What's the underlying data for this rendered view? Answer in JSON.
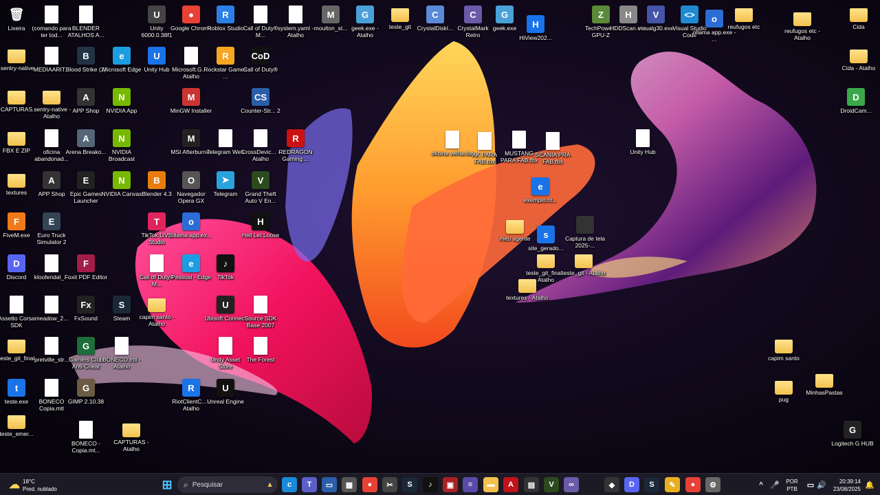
{
  "desktop": {
    "icons": [
      {
        "label": "Lixeira",
        "kind": "bin",
        "color": "#cfe3ff",
        "glyph": "🗑"
      },
      {
        "label": "(comando para ter tod...",
        "kind": "file",
        "color": "#ffffff",
        "glyph": ""
      },
      {
        "label": "BLENDER ATALHOS A...",
        "kind": "file",
        "color": "#ffffff",
        "glyph": ""
      },
      {
        "label": "Unity 6000.0.38f1",
        "kind": "app",
        "color": "#444444",
        "glyph": "U"
      },
      {
        "label": "Google Chrome",
        "kind": "app",
        "color": "#e84135",
        "glyph": "●"
      },
      {
        "label": "Roblox Studio",
        "kind": "app",
        "color": "#2b7fe6",
        "glyph": "R"
      },
      {
        "label": "Call of Duty® M...",
        "kind": "file",
        "color": "#ffffff",
        "glyph": ""
      },
      {
        "label": "system.yaml - Atalho",
        "kind": "file",
        "color": "#ffffff",
        "glyph": ""
      },
      {
        "label": "moulton_st...",
        "kind": "app",
        "color": "#666666",
        "glyph": "M"
      },
      {
        "label": "geek.exe - Atalho",
        "kind": "app",
        "color": "#4aa0d8",
        "glyph": "G"
      },
      {
        "label": "teste_git",
        "kind": "folder",
        "color": "#f2c14e",
        "glyph": ""
      },
      {
        "label": "CrystalDiskI...",
        "kind": "app",
        "color": "#5a8ad8",
        "glyph": "C"
      },
      {
        "label": "CrystalMark Retro",
        "kind": "app",
        "color": "#6a5aa8",
        "glyph": "C"
      },
      {
        "label": "geek.exe",
        "kind": "app",
        "color": "#4aa0d8",
        "glyph": "G"
      },
      {
        "label": "HiView202...",
        "kind": "app",
        "color": "#1a73e8",
        "glyph": "H"
      },
      {
        "label": "TechPowe... GPU-Z",
        "kind": "app",
        "color": "#5a8a3a",
        "glyph": "Z"
      },
      {
        "label": "HDDScan.exe",
        "kind": "app",
        "color": "#888888",
        "glyph": "H"
      },
      {
        "label": "visualg30.exe",
        "kind": "app",
        "color": "#4455aa",
        "glyph": "V"
      },
      {
        "label": "Visual Studio Code",
        "kind": "app",
        "color": "#1f8ad2",
        "glyph": "<>"
      },
      {
        "label": "ollama app.exe - ...",
        "kind": "app",
        "color": "#2c6cd6",
        "glyph": "o"
      },
      {
        "label": "reufugos etc",
        "kind": "folder",
        "color": "#f2c14e",
        "glyph": ""
      },
      {
        "label": "reufugos etc - Atalho",
        "kind": "folder",
        "color": "#f2c14e",
        "glyph": ""
      },
      {
        "label": "Cida",
        "kind": "folder",
        "color": "#f2c14e",
        "glyph": ""
      },
      {
        "label": ".sentry-native",
        "kind": "folder",
        "color": "#f2c14e",
        "glyph": ""
      },
      {
        "label": "MEDIAARIT...",
        "kind": "file",
        "color": "#ffffff",
        "glyph": ""
      },
      {
        "label": "Blood Strike (2)",
        "kind": "app",
        "color": "#223344",
        "glyph": "B"
      },
      {
        "label": "Microsoft Edge",
        "kind": "app",
        "color": "#1b9de2",
        "glyph": "e"
      },
      {
        "label": "Unity Hub",
        "kind": "app",
        "color": "#1a73e8",
        "glyph": "U"
      },
      {
        "label": "Microsoft.G... - Atalho",
        "kind": "file",
        "color": "#ffffff",
        "glyph": ""
      },
      {
        "label": "Rockstar Games ...",
        "kind": "app",
        "color": "#f5a623",
        "glyph": "R"
      },
      {
        "label": "Call of Duty®",
        "kind": "app",
        "color": "#111111",
        "glyph": "CoD"
      },
      {
        "label": "Cida - Atalho",
        "kind": "folder",
        "color": "#f2c14e",
        "glyph": ""
      },
      {
        "label": "CAPTURAS",
        "kind": "folder",
        "color": "#f2c14e",
        "glyph": ""
      },
      {
        "label": ".sentry-native - Atalho",
        "kind": "folder",
        "color": "#f2c14e",
        "glyph": ""
      },
      {
        "label": "APP Shop",
        "kind": "app",
        "color": "#333333",
        "glyph": "A"
      },
      {
        "label": "NVIDIA App",
        "kind": "app",
        "color": "#76b900",
        "glyph": "N"
      },
      {
        "label": "MinGW Installer",
        "kind": "app",
        "color": "#cc3333",
        "glyph": "M"
      },
      {
        "label": "Counter-Str... 2",
        "kind": "app",
        "color": "#2a5ea8",
        "glyph": "CS"
      },
      {
        "label": "DroidCam...",
        "kind": "app",
        "color": "#3aa84a",
        "glyph": "D"
      },
      {
        "label": "FBX E ZIP",
        "kind": "folder",
        "color": "#f2c14e",
        "glyph": ""
      },
      {
        "label": "oficina abandonad...",
        "kind": "file",
        "color": "#ffffff",
        "glyph": ""
      },
      {
        "label": "Arena Breako...",
        "kind": "app",
        "color": "#556677",
        "glyph": "A"
      },
      {
        "label": "NVIDIA Broadcast",
        "kind": "app",
        "color": "#76b900",
        "glyph": "N"
      },
      {
        "label": "MSI Afterburner",
        "kind": "app",
        "color": "#222222",
        "glyph": "M"
      },
      {
        "label": "Telegram Web",
        "kind": "file",
        "color": "#ffffff",
        "glyph": ""
      },
      {
        "label": "CrossDevic... - Atalho",
        "kind": "file",
        "color": "#ffffff",
        "glyph": ""
      },
      {
        "label": "REDRAGON Gaming ...",
        "kind": "app",
        "color": "#cc1111",
        "glyph": "R"
      },
      {
        "label": "oficina velha.fbx",
        "kind": "file",
        "color": "#ffffff",
        "glyph": ""
      },
      {
        "label": "AK PARA FAB.fbx",
        "kind": "file",
        "color": "#ffffff",
        "glyph": ""
      },
      {
        "label": "MUSTANG PARA FAB.fbx",
        "kind": "file",
        "color": "#ffffff",
        "glyph": ""
      },
      {
        "label": "SCANIA PRA FAB.fbx",
        "kind": "file",
        "color": "#ffffff",
        "glyph": ""
      },
      {
        "label": "Unity Hub",
        "kind": "file",
        "color": "#ffffff",
        "glyph": ""
      },
      {
        "label": "textures",
        "kind": "folder",
        "color": "#f2c14e",
        "glyph": ""
      },
      {
        "label": "APP Shop",
        "kind": "app",
        "color": "#333333",
        "glyph": "A"
      },
      {
        "label": "Epic Games Launcher",
        "kind": "app",
        "color": "#222222",
        "glyph": "E"
      },
      {
        "label": "NVIDIA Canvas",
        "kind": "app",
        "color": "#76b900",
        "glyph": "N"
      },
      {
        "label": "Blender 4.3",
        "kind": "app",
        "color": "#e87d0d",
        "glyph": "B"
      },
      {
        "label": "Navegador Opera GX",
        "kind": "app",
        "color": "#555555",
        "glyph": "O"
      },
      {
        "label": "Telegram",
        "kind": "app",
        "color": "#2aa3dd",
        "glyph": "➤"
      },
      {
        "label": "Grand Theft Auto V En...",
        "kind": "app",
        "color": "#2c4a1e",
        "glyph": "V"
      },
      {
        "label": "exemplo.ht...",
        "kind": "app",
        "color": "#1a73e8",
        "glyph": "e"
      },
      {
        "label": "FiveM.exe",
        "kind": "app",
        "color": "#f07a1a",
        "glyph": "F"
      },
      {
        "label": "Euro Truck Simulator 2",
        "kind": "app",
        "color": "#334455",
        "glyph": "E"
      },
      {
        "label": "TikTok LIVE Studio",
        "kind": "app",
        "color": "#e0245e",
        "glyph": "T"
      },
      {
        "label": "ollama app.ex...",
        "kind": "app",
        "color": "#2c6cd6",
        "glyph": "o"
      },
      {
        "label": "Hell Let Loose",
        "kind": "app",
        "color": "#111111",
        "glyph": "H"
      },
      {
        "label": "meu agente",
        "kind": "folder",
        "color": "#f2c14e",
        "glyph": ""
      },
      {
        "label": "site_gerado...",
        "kind": "app",
        "color": "#1a73e8",
        "glyph": "s"
      },
      {
        "label": "Captura de tela 2025-...",
        "kind": "app",
        "color": "#333333",
        "glyph": ""
      },
      {
        "label": "Discord",
        "kind": "app",
        "color": "#5865f2",
        "glyph": "D"
      },
      {
        "label": "kloofendal_...",
        "kind": "file",
        "color": "#ffffff",
        "glyph": ""
      },
      {
        "label": "Foxit PDF Editor",
        "kind": "app",
        "color": "#a21d48",
        "glyph": "F"
      },
      {
        "label": "Call of Duty® M...",
        "kind": "file",
        "color": "#ffffff",
        "glyph": ""
      },
      {
        "label": "Pessoal - Edge",
        "kind": "app",
        "color": "#1b9de2",
        "glyph": "e"
      },
      {
        "label": "TikTok",
        "kind": "app",
        "color": "#111111",
        "glyph": "♪"
      },
      {
        "label": "teste_git_final - Atalho",
        "kind": "folder",
        "color": "#f2c14e",
        "glyph": ""
      },
      {
        "label": "teste_git - Atalho",
        "kind": "folder",
        "color": "#f2c14e",
        "glyph": ""
      },
      {
        "label": "textures - Atalho",
        "kind": "folder",
        "color": "#f2c14e",
        "glyph": ""
      },
      {
        "label": "Assetto Corsa SDK",
        "kind": "file",
        "color": "#ffffff",
        "glyph": ""
      },
      {
        "label": "meadow_2...",
        "kind": "file",
        "color": "#ffffff",
        "glyph": ""
      },
      {
        "label": "FxSound",
        "kind": "app",
        "color": "#222222",
        "glyph": "Fx"
      },
      {
        "label": "Steam",
        "kind": "app",
        "color": "#1b2838",
        "glyph": "S"
      },
      {
        "label": "capim santo - Atalho",
        "kind": "folder",
        "color": "#f2c14e",
        "glyph": ""
      },
      {
        "label": "Ubisoft Connect",
        "kind": "app",
        "color": "#222222",
        "glyph": "U"
      },
      {
        "label": "Source SDK Base 2007",
        "kind": "file",
        "color": "#ffffff",
        "glyph": ""
      },
      {
        "label": "capim santo",
        "kind": "folder",
        "color": "#f2c14e",
        "glyph": ""
      },
      {
        "label": "teste_git_final",
        "kind": "folder",
        "color": "#f2c14e",
        "glyph": ""
      },
      {
        "label": "pretville_str...",
        "kind": "file",
        "color": "#ffffff",
        "glyph": ""
      },
      {
        "label": "Gamers Club Anti-Cheat",
        "kind": "app",
        "color": "#1e6e3a",
        "glyph": "G"
      },
      {
        "label": "BONECO.mtl - Atalho",
        "kind": "file",
        "color": "#ffffff",
        "glyph": ""
      },
      {
        "label": "Unity Asset Store",
        "kind": "file",
        "color": "#ffffff",
        "glyph": ""
      },
      {
        "label": "The Forest",
        "kind": "file",
        "color": "#ffffff",
        "glyph": ""
      },
      {
        "label": "pug",
        "kind": "folder",
        "color": "#f2c14e",
        "glyph": ""
      },
      {
        "label": "MinhasPastas",
        "kind": "folder",
        "color": "#f2c14e",
        "glyph": ""
      },
      {
        "label": "teste.exe",
        "kind": "app",
        "color": "#1a73e8",
        "glyph": "t"
      },
      {
        "label": "BONECO Copia.mtl",
        "kind": "file",
        "color": "#ffffff",
        "glyph": ""
      },
      {
        "label": "GIMP 2.10.38",
        "kind": "app",
        "color": "#6b5b45",
        "glyph": "G"
      },
      {
        "label": "RiotClientC... - Atalho",
        "kind": "app",
        "color": "#1a73e8",
        "glyph": "R"
      },
      {
        "label": "Unreal Engine",
        "kind": "app",
        "color": "#111111",
        "glyph": "U"
      },
      {
        "label": "teste_emer...",
        "kind": "folder",
        "color": "#f2c14e",
        "glyph": ""
      },
      {
        "label": "BONECO - Copia.mt...",
        "kind": "file",
        "color": "#ffffff",
        "glyph": ""
      },
      {
        "label": "CAPTURAS - Atalho",
        "kind": "folder",
        "color": "#f2c14e",
        "glyph": ""
      },
      {
        "label": "Logitech G HUB",
        "kind": "app",
        "color": "#222222",
        "glyph": "G"
      }
    ]
  },
  "taskbar": {
    "weather": {
      "temp": "18°C",
      "desc": "Pred. nublado"
    },
    "search_placeholder": "Pesquisar",
    "apps": [
      {
        "name": "start-button",
        "color": "#4cc2ff",
        "glyph": "⊞"
      },
      {
        "name": "copilot",
        "color": "#1a8ad8",
        "glyph": "c"
      },
      {
        "name": "teams",
        "color": "#5b5fc7",
        "glyph": "T"
      },
      {
        "name": "task-view",
        "color": "#2a5ea8",
        "glyph": "▭"
      },
      {
        "name": "calculator",
        "color": "#555555",
        "glyph": "▦"
      },
      {
        "name": "chrome",
        "color": "#e84135",
        "glyph": "●"
      },
      {
        "name": "snipping",
        "color": "#444444",
        "glyph": "✂"
      },
      {
        "name": "steam",
        "color": "#1b2838",
        "glyph": "S"
      },
      {
        "name": "tiktok",
        "color": "#111111",
        "glyph": "♪"
      },
      {
        "name": "photos",
        "color": "#aa2222",
        "glyph": "▣"
      },
      {
        "name": "notepad",
        "color": "#5a4aa8",
        "glyph": "≡"
      },
      {
        "name": "file-explorer",
        "color": "#f2c14e",
        "glyph": "▬"
      },
      {
        "name": "acrobat",
        "color": "#c0131a",
        "glyph": "A"
      },
      {
        "name": "store",
        "color": "#333333",
        "glyph": "▤"
      },
      {
        "name": "gta",
        "color": "#2c4a1e",
        "glyph": "V"
      },
      {
        "name": "copilot-2",
        "color": "#6a5aa8",
        "glyph": "∞"
      },
      {
        "name": "security",
        "color": "#333333",
        "glyph": "◆"
      },
      {
        "name": "discord",
        "color": "#5865f2",
        "glyph": "D"
      },
      {
        "name": "steam-2",
        "color": "#1b2838",
        "glyph": "S"
      },
      {
        "name": "vscode-taskbar",
        "color": "#e8b020",
        "glyph": "✎"
      },
      {
        "name": "chrome-2",
        "color": "#e84135",
        "glyph": "●"
      },
      {
        "name": "settings",
        "color": "#666666",
        "glyph": "⚙"
      },
      {
        "name": "chrome-3",
        "color": "#e84135",
        "glyph": "●"
      }
    ],
    "tray": {
      "lang": "POR",
      "layout": "PTB",
      "time": "20:39:14",
      "date": "23/08/2025"
    }
  }
}
